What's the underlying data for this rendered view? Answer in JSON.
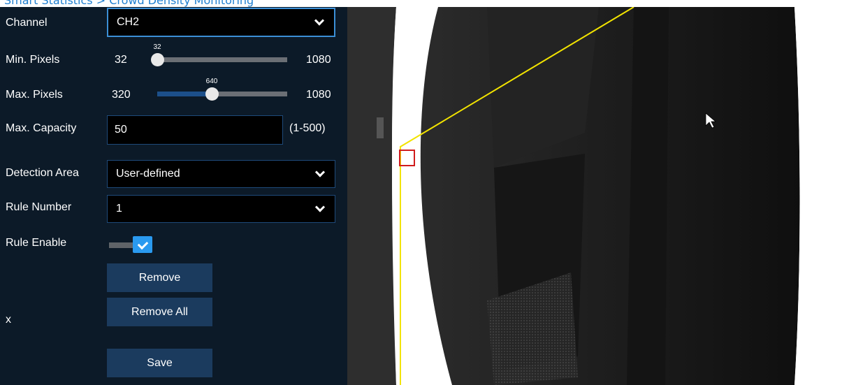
{
  "header": {
    "cut_text": "Smart Statistics > Crowd Density Monitoring"
  },
  "form": {
    "channel": {
      "label": "Channel",
      "value": "CH2"
    },
    "min_pixels": {
      "label": "Min. Pixels",
      "min": "32",
      "max": "1080",
      "value": "32",
      "fraction": 0.0
    },
    "max_pixels": {
      "label": "Max. Pixels",
      "min": "320",
      "max": "1080",
      "value": "640",
      "fraction": 0.42
    },
    "max_capacity": {
      "label": "Max. Capacity",
      "value": "50",
      "range": "(1-500)"
    },
    "detection_area": {
      "label": "Detection Area",
      "value": "User-defined"
    },
    "rule_number": {
      "label": "Rule Number",
      "value": "1"
    },
    "rule_enable": {
      "label": "Rule Enable",
      "checked": true
    },
    "cut_char": "x"
  },
  "buttons": {
    "remove": "Remove",
    "remove_all": "Remove All",
    "save": "Save"
  },
  "colors": {
    "panel_bg": "#0c1a28",
    "button_bg": "#1b3b5e",
    "accent": "#2a9af0",
    "detection_line": "#f2e300",
    "marker": "#d01c1c"
  },
  "icons": {
    "dropdown": "chevron-down-icon",
    "toggle": "check-icon",
    "cursor": "mouse-pointer-icon"
  }
}
